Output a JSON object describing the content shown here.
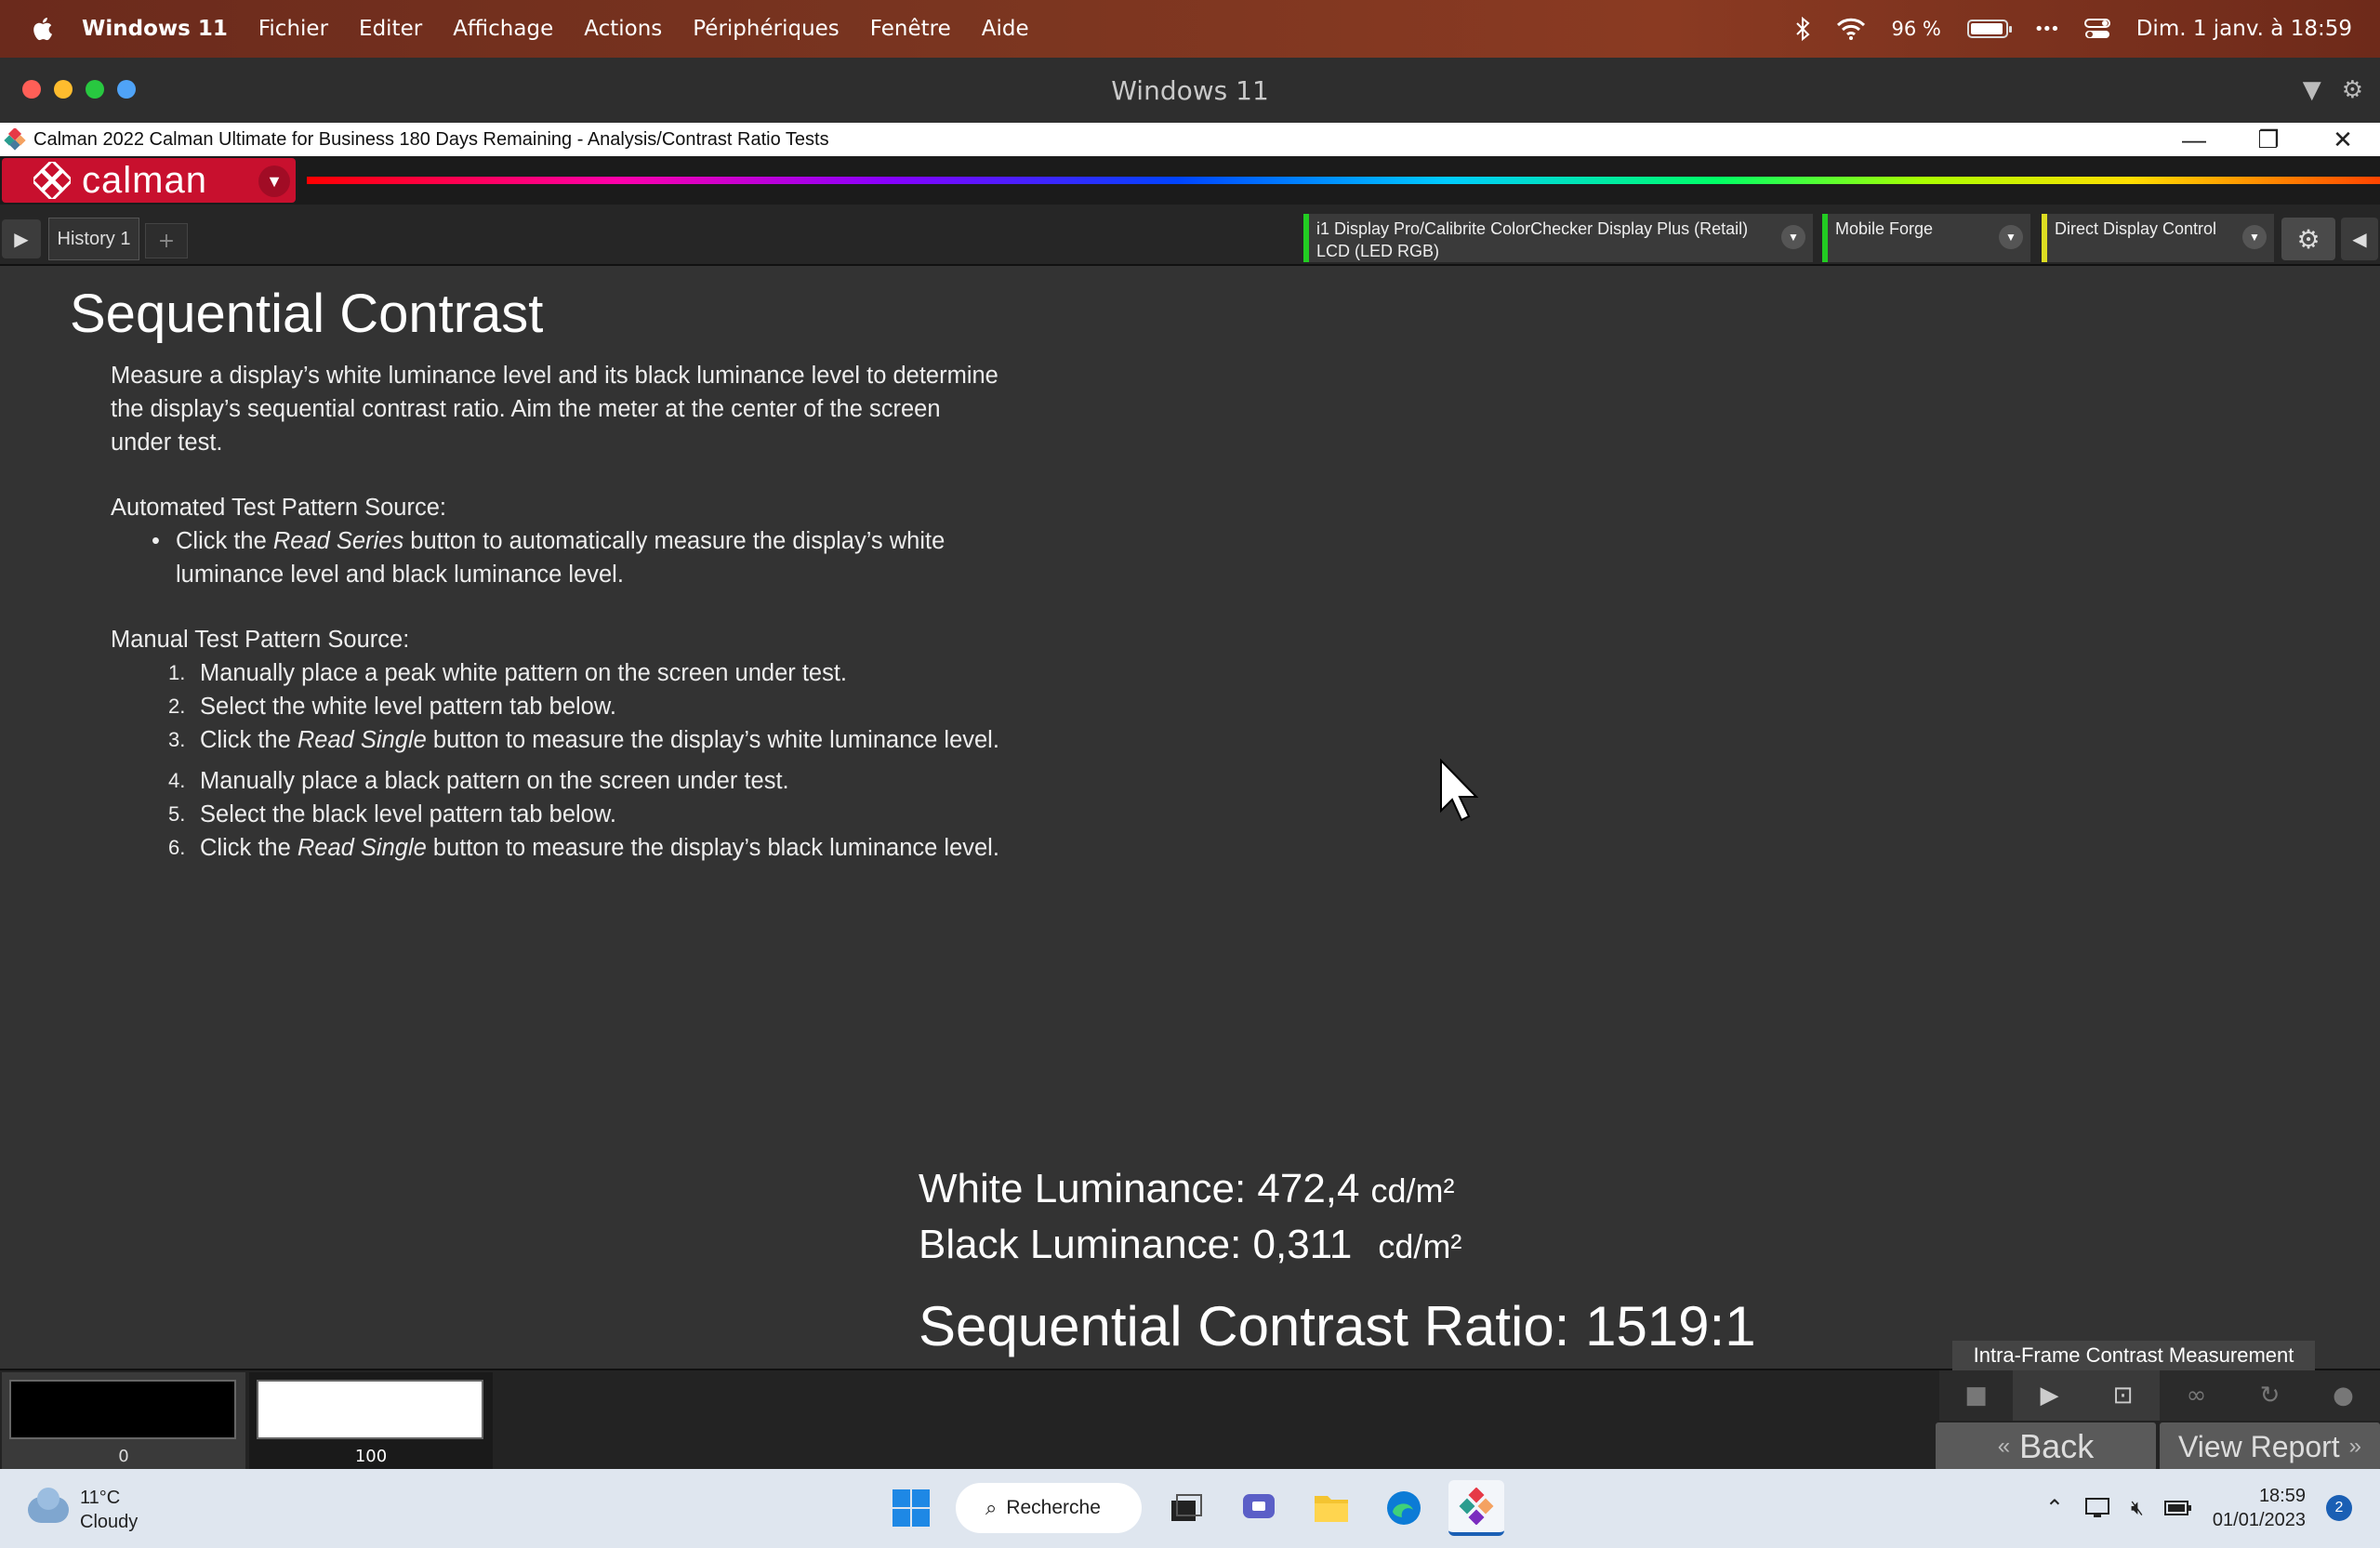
{
  "menubar": {
    "app_name": "Windows 11",
    "items": [
      "Fichier",
      "Editer",
      "Affichage",
      "Actions",
      "Périphériques",
      "Fenêtre",
      "Aide"
    ],
    "battery_percent_text": "96 %",
    "battery_level": 0.96,
    "datetime": "Dim. 1 janv. à 18:59",
    "more_glyph": "•••"
  },
  "window": {
    "title": "Windows 11",
    "traffic_colors": [
      "#ff5f57",
      "#febc2e",
      "#28c840",
      "#4fa3f7"
    ]
  },
  "app": {
    "title": "Calman 2022 Calman Ultimate for Business 180 Days Remaining  - Analysis/Contrast Ratio Tests",
    "minimize_glyph": "—",
    "restore_glyph": "❐",
    "close_glyph": "✕"
  },
  "calman": {
    "logo_text": "calman",
    "history_tab": "History 1",
    "add_tab_glyph": "+",
    "devices": [
      {
        "line1": "i1 Display Pro/Calibrite ColorChecker Display Plus (Retail)",
        "line2": "LCD (LED RGB)",
        "status_color": "#22cc22"
      },
      {
        "line1": "Mobile Forge",
        "line2": "",
        "status_color": "#22cc22"
      },
      {
        "line1": "Direct Display Control",
        "line2": "",
        "status_color": "#dddd22"
      }
    ]
  },
  "content": {
    "title": "Sequential Contrast",
    "intro": "Measure a display’s white luminance level and its black luminance level to determine the display’s sequential contrast ratio. Aim the meter at the center of the screen under test.",
    "auto_heading": "Automated Test Pattern Source:",
    "auto_bullet": {
      "pre": "Click the ",
      "em": "Read Series",
      "post": " button to automatically measure the display’s white luminance level and black luminance level."
    },
    "manual_heading": "Manual Test Pattern Source:",
    "steps": [
      {
        "num": "1.",
        "pre": "Manually place a peak white pattern on the screen under test.",
        "em": "",
        "post": ""
      },
      {
        "num": "2.",
        "pre": "Select the white level pattern tab below.",
        "em": "",
        "post": ""
      },
      {
        "num": "3.",
        "pre": "Click the ",
        "em": "Read Single",
        "post": " button to measure the display’s white luminance level."
      },
      {
        "num": "4.",
        "pre": "Manually place a black pattern on the screen under test.",
        "em": "",
        "post": ""
      },
      {
        "num": "5.",
        "pre": "Select the black level pattern tab below.",
        "em": "",
        "post": ""
      },
      {
        "num": "6.",
        "pre": "Click the ",
        "em": "Read Single",
        "post": " button to measure the display’s black luminance level."
      }
    ],
    "white_label": "White Luminance: 472,4",
    "black_label": "Black Luminance: 0,311",
    "unit": "cd/m²",
    "ratio_label": "Sequential Contrast Ratio:  1519:1"
  },
  "bottom": {
    "swatches": [
      {
        "label": "0",
        "color": "#000000"
      },
      {
        "label": "100",
        "color": "#ffffff"
      }
    ],
    "intra_label": "Intra-Frame Contrast Measurement",
    "back_label": "Back",
    "report_label": "View Report"
  },
  "taskbar": {
    "temp": "11°C",
    "condition": "Cloudy",
    "search_label": "Recherche",
    "time": "18:59",
    "date": "01/01/2023",
    "notifications": "2"
  }
}
